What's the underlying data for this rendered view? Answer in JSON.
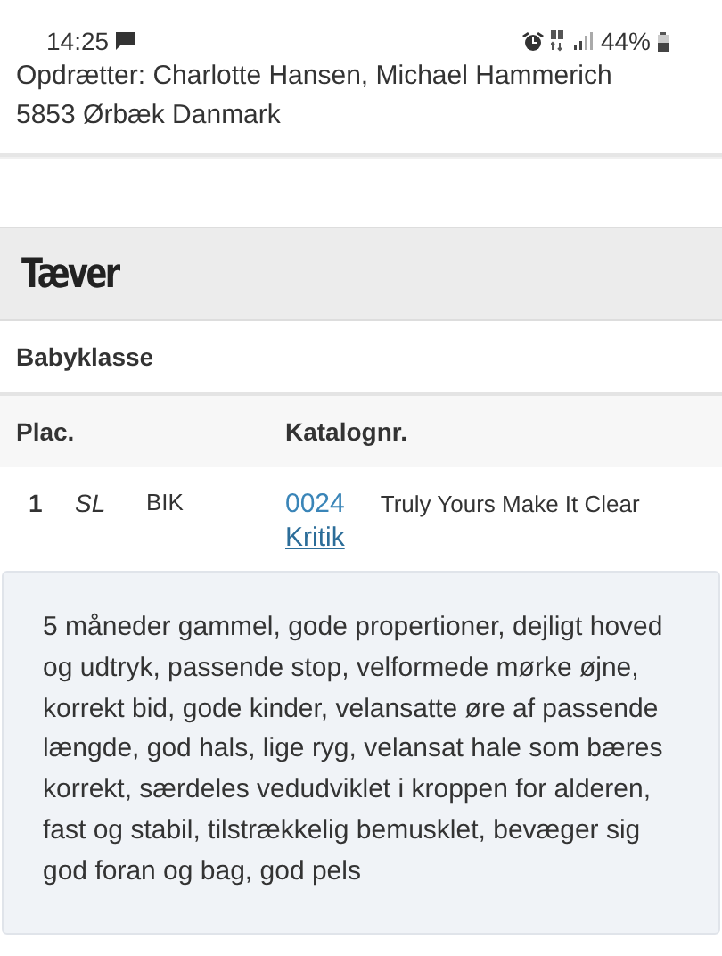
{
  "status_bar": {
    "time": "14:25",
    "battery": "44%"
  },
  "breeder": {
    "names": "Opdrætter: Charlotte Hansen, Michael Hammerich",
    "address": "5853 Ørbæk Danmark"
  },
  "section_title": "Tæver",
  "class_name": "Babyklasse",
  "table": {
    "columns": [
      "Plac.",
      "Katalognr."
    ],
    "rows": [
      {
        "placement": "1",
        "award": "SL",
        "grade": "BIK",
        "catalog_number": "0024",
        "dog_name": "Truly Yours Make It Clear",
        "critique_link": "Kritik",
        "critique": "5 måneder gammel, gode propertioner, dejligt hoved og udtryk, passende stop, velformede mørke øjne, korrekt bid, gode kinder, velansatte øre af passende længde, god hals, lige ryg, velansat hale som bæres korrekt, særdeles vedudviklet i kroppen for alderen, fast og stabil, tilstrækkelig bemusklet, bevæger sig god foran og bag, god pels"
      }
    ]
  }
}
